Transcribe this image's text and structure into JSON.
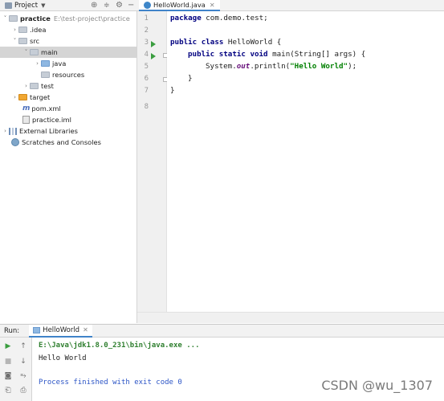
{
  "project_panel": {
    "title": "Project",
    "tree": [
      {
        "label": "practice",
        "hint": "E:\\test-project\\practice",
        "bold": true,
        "icon": "folder",
        "arrow": "˅"
      },
      {
        "label": ".idea",
        "icon": "folder",
        "arrow": "›"
      },
      {
        "label": "src",
        "icon": "folder",
        "arrow": "˅"
      },
      {
        "label": "main",
        "icon": "folder",
        "arrow": "˅"
      },
      {
        "label": "java",
        "icon": "folder-blue",
        "arrow": "›"
      },
      {
        "label": "resources",
        "icon": "folder-resources",
        "arrow": ""
      },
      {
        "label": "test",
        "icon": "folder",
        "arrow": "›"
      },
      {
        "label": "target",
        "icon": "folder-orange",
        "arrow": "›"
      },
      {
        "label": "pom.xml",
        "icon": "maven-file-icon",
        "arrow": ""
      },
      {
        "label": "practice.iml",
        "icon": "module-file-icon",
        "arrow": ""
      },
      {
        "label": "External Libraries",
        "icon": "libraries-icon",
        "arrow": "›"
      },
      {
        "label": "Scratches and Consoles",
        "icon": "scratches-icon",
        "arrow": ""
      }
    ]
  },
  "editor": {
    "tab_label": "HelloWorld.java",
    "line_numbers": [
      "1",
      "2",
      "3",
      "4",
      "5",
      "6",
      "7",
      "8"
    ],
    "code": {
      "l1_kw": "package",
      "l1_rest": " com.demo.test;",
      "l3_kw": "public class",
      "l3_rest": " HelloWorld {",
      "l4_kw": "public static void",
      "l4_rest": " main(String[] args) {",
      "l5_pre": "System.",
      "l5_out": "out",
      "l5_mid": ".println(",
      "l5_str": "\"Hello World\"",
      "l5_end": ");",
      "l6": "}",
      "l7": "}"
    }
  },
  "run_panel": {
    "label": "Run:",
    "tab_label": "HelloWorld",
    "console_lines": [
      "E:\\Java\\jdk1.8.0_231\\bin\\java.exe ...",
      "Hello World",
      "",
      "Process finished with exit code 0"
    ]
  },
  "watermark": "CSDN @wu_1307",
  "colors": {
    "accent": "#4083c9",
    "run_green": "#3a9d3f",
    "keyword": "#000080",
    "string": "#008000",
    "exit_blue": "#2c55c6"
  }
}
